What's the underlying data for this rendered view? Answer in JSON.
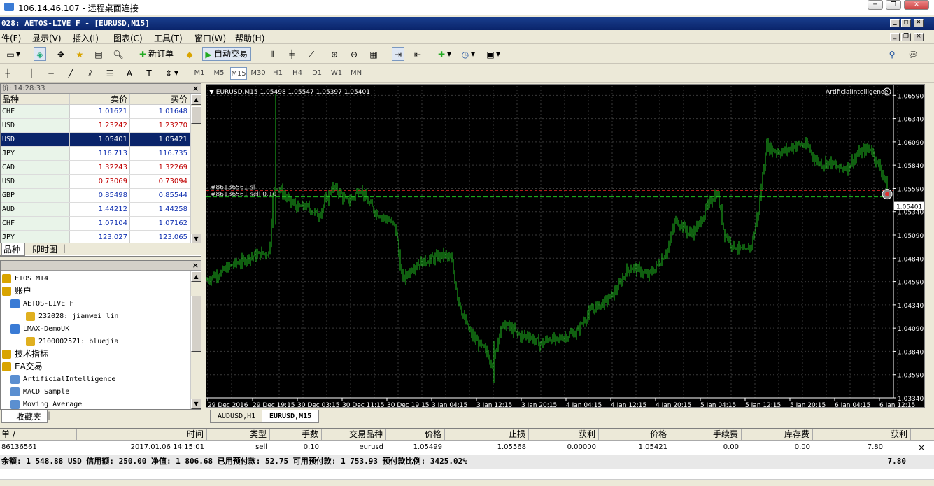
{
  "rdp": {
    "title": "106.14.46.107 - 远程桌面连接"
  },
  "window": {
    "title": "028: AETOS-LIVE F - [EURUSD,M15]"
  },
  "menu": [
    "件(F)",
    "显示(V)",
    "插入(I)",
    "图表(C)",
    "工具(T)",
    "窗口(W)",
    "帮助(H)"
  ],
  "toolbar": {
    "new_order": "新订单",
    "auto_trade": "自动交易"
  },
  "timeframes": [
    "M1",
    "M5",
    "M15",
    "M30",
    "H1",
    "H4",
    "D1",
    "W1",
    "MN"
  ],
  "active_timeframe": "M15",
  "market_watch": {
    "title": "价: 14:28:33",
    "headers": [
      "品种",
      "卖价",
      "买价"
    ],
    "rows": [
      {
        "symbol": "CHF",
        "bid": "1.01621",
        "ask": "1.01648",
        "dir": "blue"
      },
      {
        "symbol": "USD",
        "bid": "1.23242",
        "ask": "1.23270",
        "dir": "red"
      },
      {
        "symbol": "USD",
        "bid": "1.05401",
        "ask": "1.05421",
        "dir": "sel"
      },
      {
        "symbol": "JPY",
        "bid": "116.713",
        "ask": "116.735",
        "dir": "blue"
      },
      {
        "symbol": "CAD",
        "bid": "1.32243",
        "ask": "1.32269",
        "dir": "red"
      },
      {
        "symbol": "USD",
        "bid": "0.73069",
        "ask": "0.73094",
        "dir": "red"
      },
      {
        "symbol": "GBP",
        "bid": "0.85498",
        "ask": "0.85544",
        "dir": "blue"
      },
      {
        "symbol": "AUD",
        "bid": "1.44212",
        "ask": "1.44258",
        "dir": "blue"
      },
      {
        "symbol": "CHF",
        "bid": "1.07104",
        "ask": "1.07162",
        "dir": "blue"
      },
      {
        "symbol": "JPY",
        "bid": "123.027",
        "ask": "123.065",
        "dir": "blue"
      }
    ],
    "tabs": [
      "品种",
      "即时图"
    ]
  },
  "navigator": {
    "items": [
      {
        "text": "ETOS MT4",
        "level": 0,
        "icon": "folder-icon"
      },
      {
        "text": "账户",
        "level": 0,
        "icon": "accounts-icon"
      },
      {
        "text": "AETOS-LIVE F",
        "level": 1,
        "icon": "server-icon"
      },
      {
        "text": "232028: jianwei lin",
        "level": 2,
        "icon": "user-icon"
      },
      {
        "text": "LMAX-DemoUK",
        "level": 1,
        "icon": "server-icon"
      },
      {
        "text": "2100002571: bluejia",
        "level": 2,
        "icon": "user-icon"
      },
      {
        "text": "技术指标",
        "level": 0,
        "icon": "indicators-icon"
      },
      {
        "text": "EA交易",
        "level": 0,
        "icon": "expert-icon"
      },
      {
        "text": "ArtificialIntelligence",
        "level": 1,
        "icon": "expert-item-icon"
      },
      {
        "text": "MACD Sample",
        "level": 1,
        "icon": "expert-item-icon"
      },
      {
        "text": "Moving Average",
        "level": 1,
        "icon": "expert-item-icon"
      }
    ],
    "tab": "收藏夹"
  },
  "chart": {
    "header": "EURUSD,M15  1.05498 1.05547 1.05397 1.05401",
    "ea_label": "ArtificialIntelligence",
    "sl_label": "#86136561 sl",
    "order_label": "#86136561 sell 0.10",
    "current_price": "1.05401",
    "tabs": [
      "AUDUSD,H1",
      "EURUSD,M15"
    ],
    "active_tab": "EURUSD,M15"
  },
  "chart_data": {
    "type": "candlestick",
    "y_ticks": [
      "1.06590",
      "1.06340",
      "1.06090",
      "1.05840",
      "1.05590",
      "1.05340",
      "1.05090",
      "1.04840",
      "1.04590",
      "1.04340",
      "1.04090",
      "1.03840",
      "1.03590",
      "1.03340"
    ],
    "x_ticks": [
      "29 Dec 2016",
      "29 Dec 19:15",
      "30 Dec 03:15",
      "30 Dec 11:15",
      "30 Dec 19:15",
      "3 Jan 04:15",
      "3 Jan 12:15",
      "3 Jan 20:15",
      "4 Jan 04:15",
      "4 Jan 12:15",
      "4 Jan 20:15",
      "5 Jan 04:15",
      "5 Jan 12:15",
      "5 Jan 20:15",
      "6 Jan 04:15",
      "6 Jan 12:15"
    ],
    "ylim": [
      1.0334,
      1.0669
    ],
    "close_path": [
      [
        0,
        1.046
      ],
      [
        10,
        1.0465
      ],
      [
        20,
        1.0468
      ],
      [
        30,
        1.0474
      ],
      [
        40,
        1.0478
      ],
      [
        50,
        1.048
      ],
      [
        60,
        1.0485
      ],
      [
        70,
        1.0487
      ],
      [
        80,
        1.0489
      ],
      [
        90,
        1.049
      ],
      [
        95,
        1.055
      ],
      [
        100,
        1.0562
      ],
      [
        110,
        1.0553
      ],
      [
        120,
        1.0545
      ],
      [
        130,
        1.0538
      ],
      [
        140,
        1.054
      ],
      [
        150,
        1.0536
      ],
      [
        160,
        1.053
      ],
      [
        170,
        1.0545
      ],
      [
        180,
        1.056
      ],
      [
        190,
        1.0555
      ],
      [
        200,
        1.0545
      ],
      [
        210,
        1.055
      ],
      [
        220,
        1.056
      ],
      [
        230,
        1.0545
      ],
      [
        240,
        1.0535
      ],
      [
        250,
        1.053
      ],
      [
        260,
        1.0525
      ],
      [
        270,
        1.0518
      ],
      [
        280,
        1.046
      ],
      [
        290,
        1.047
      ],
      [
        300,
        1.0478
      ],
      [
        310,
        1.048
      ],
      [
        320,
        1.0483
      ],
      [
        330,
        1.0485
      ],
      [
        340,
        1.0488
      ],
      [
        350,
        1.0482
      ],
      [
        360,
        1.044
      ],
      [
        370,
        1.0415
      ],
      [
        380,
        1.04
      ],
      [
        390,
        1.0392
      ],
      [
        400,
        1.0383
      ],
      [
        410,
        1.037
      ],
      [
        420,
        1.041
      ],
      [
        430,
        1.0412
      ],
      [
        440,
        1.0405
      ],
      [
        450,
        1.04
      ],
      [
        460,
        1.0402
      ],
      [
        470,
        1.0395
      ],
      [
        480,
        1.0392
      ],
      [
        490,
        1.0398
      ],
      [
        500,
        1.0395
      ],
      [
        510,
        1.04
      ],
      [
        520,
        1.0402
      ],
      [
        530,
        1.0405
      ],
      [
        540,
        1.0418
      ],
      [
        550,
        1.0428
      ],
      [
        560,
        1.0433
      ],
      [
        570,
        1.0437
      ],
      [
        580,
        1.0445
      ],
      [
        590,
        1.0455
      ],
      [
        600,
        1.047
      ],
      [
        610,
        1.0475
      ],
      [
        620,
        1.047
      ],
      [
        630,
        1.0465
      ],
      [
        640,
        1.0472
      ],
      [
        650,
        1.0482
      ],
      [
        660,
        1.0495
      ],
      [
        670,
        1.0525
      ],
      [
        680,
        1.052
      ],
      [
        690,
        1.051
      ],
      [
        700,
        1.0515
      ],
      [
        710,
        1.053
      ],
      [
        720,
        1.0545
      ],
      [
        730,
        1.0555
      ],
      [
        740,
        1.0512
      ],
      [
        750,
        1.05
      ],
      [
        760,
        1.0495
      ],
      [
        770,
        1.049
      ],
      [
        780,
        1.05
      ],
      [
        790,
        1.054
      ],
      [
        800,
        1.0605
      ],
      [
        810,
        1.06
      ],
      [
        820,
        1.0598
      ],
      [
        830,
        1.06
      ],
      [
        840,
        1.0605
      ],
      [
        850,
        1.0606
      ],
      [
        860,
        1.0604
      ],
      [
        870,
        1.059
      ],
      [
        880,
        1.0585
      ],
      [
        890,
        1.0588
      ],
      [
        900,
        1.0582
      ],
      [
        910,
        1.058
      ],
      [
        920,
        1.0585
      ],
      [
        930,
        1.0595
      ],
      [
        940,
        1.06
      ],
      [
        950,
        1.0602
      ],
      [
        960,
        1.0585
      ],
      [
        970,
        1.057
      ],
      [
        975,
        1.0548
      ]
    ],
    "order_price": 1.05499,
    "sl_price": 1.05568,
    "bid": 1.05401
  },
  "terminal": {
    "headers": [
      "单 /",
      "时间",
      "类型",
      "手数",
      "交易品种",
      "价格",
      "止损",
      "获利",
      "价格",
      "手续费",
      "库存费",
      "获利"
    ],
    "row": [
      "86136561",
      "2017.01.06 14:15:01",
      "sell",
      "0.10",
      "eurusd",
      "1.05499",
      "1.05568",
      "0.00000",
      "1.05421",
      "0.00",
      "0.00",
      "7.80"
    ],
    "balance": "余额: 1 548.88 USD  信用额: 250.00  净值: 1 806.68  已用预付款: 52.75  可用预付款: 1 753.93  预付款比例: 3425.02%",
    "balance_profit": "7.80"
  },
  "colors": {
    "bull": "#20c020",
    "bear": "#20c020",
    "grid": "#3a3a3a",
    "sl_line": "#d02020",
    "order_line": "#20c020",
    "title_bg": "#0a246a"
  }
}
